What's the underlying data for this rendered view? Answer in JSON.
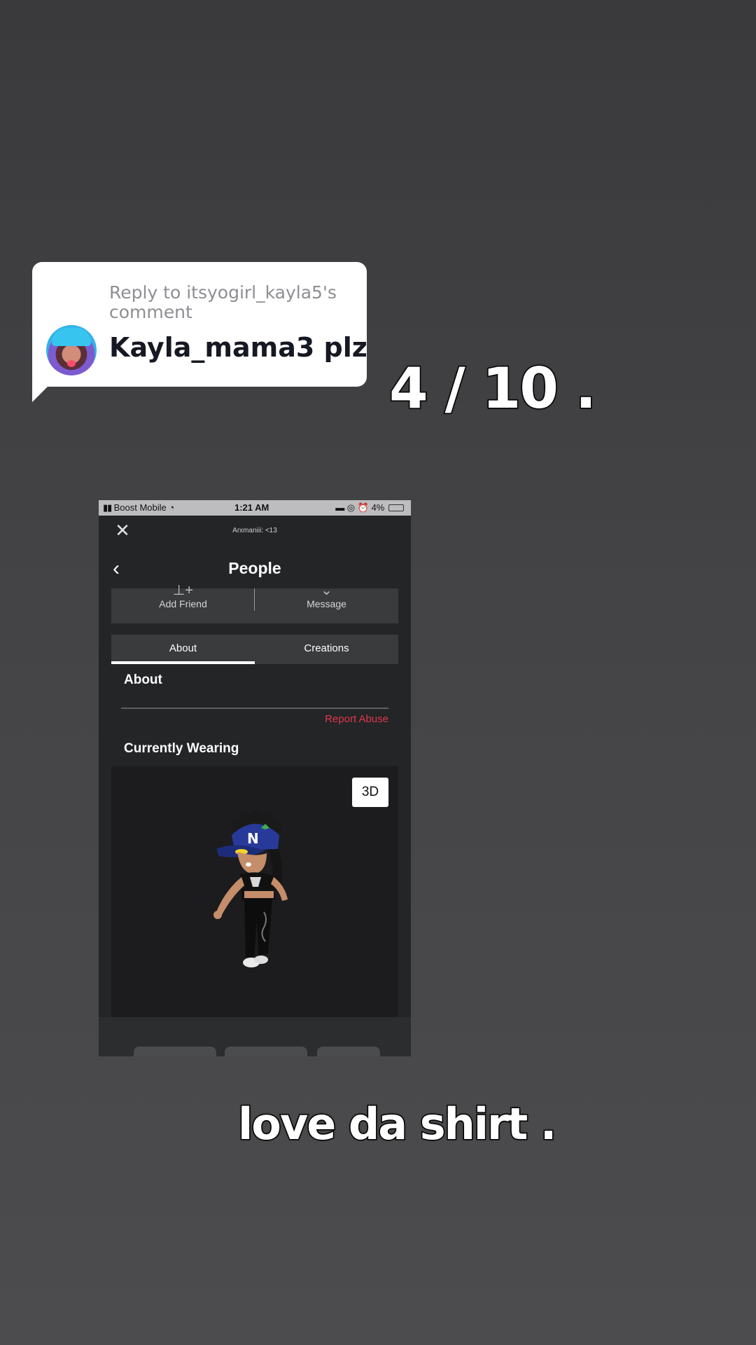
{
  "reply": {
    "header": "Reply to itsyogirl_kayla5's comment",
    "comment": "Kayla_mama3 plz"
  },
  "overlay": {
    "rating": "4 / 10 .",
    "caption": "love da shirt ."
  },
  "phone": {
    "status": {
      "carrier": "Boost Mobile",
      "time": "1:21 AM",
      "battery": "4%"
    },
    "subtitle": "Arxmaniii: <13",
    "title": "People",
    "actions": {
      "add_friend": "Add Friend",
      "message": "Message"
    },
    "tabs": [
      {
        "label": "About",
        "active": true
      },
      {
        "label": "Creations",
        "active": false
      }
    ],
    "about_title": "About",
    "report_abuse": "Report Abuse",
    "wearing_title": "Currently Wearing",
    "view_3d": "3D"
  },
  "colors": {
    "report": "#e2364c",
    "tab_indicator": "#ffffff"
  },
  "icons": [
    "close-icon",
    "back-chevron-icon",
    "add-friend-icon",
    "message-chevron-icon",
    "wifi-icon",
    "battery-icon"
  ]
}
